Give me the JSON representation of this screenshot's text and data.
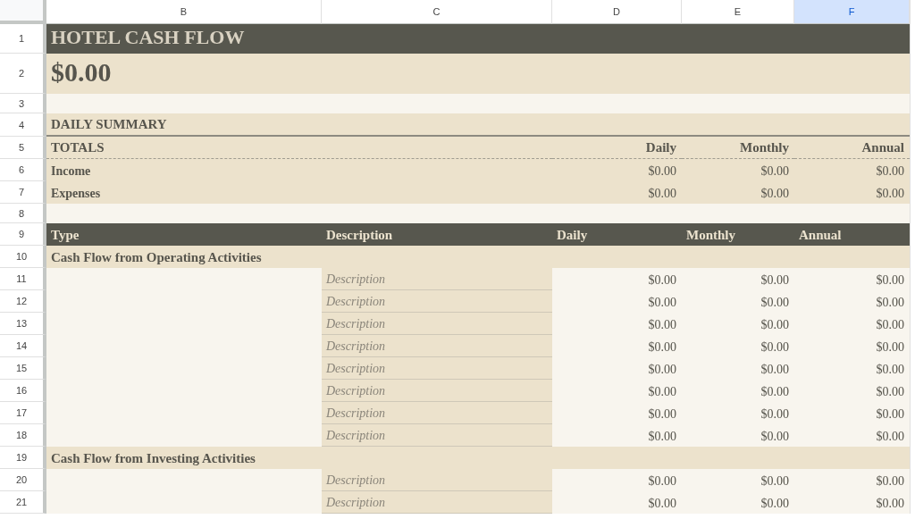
{
  "column_headers": [
    {
      "label": "B",
      "selected": false
    },
    {
      "label": "C",
      "selected": false
    },
    {
      "label": "D",
      "selected": false
    },
    {
      "label": "E",
      "selected": false
    },
    {
      "label": "F",
      "selected": true
    }
  ],
  "row_numbers": [
    "1",
    "2",
    "3",
    "4",
    "5",
    "6",
    "7",
    "8",
    "9",
    "10",
    "11",
    "12",
    "13",
    "14",
    "15",
    "16",
    "17",
    "18",
    "19",
    "20",
    "21"
  ],
  "title": "HOTEL CASH FLOW",
  "total": "$0.00",
  "summary": {
    "heading": "DAILY SUMMARY",
    "label": "TOTALS",
    "columns": [
      "Daily",
      "Monthly",
      "Annual"
    ],
    "rows": [
      {
        "label": "Income",
        "values": [
          "$0.00",
          "$0.00",
          "$0.00"
        ]
      },
      {
        "label": "Expenses",
        "values": [
          "$0.00",
          "$0.00",
          "$0.00"
        ]
      }
    ]
  },
  "cash_flow": {
    "columns": [
      "Type",
      "Description",
      "Daily",
      "Monthly",
      "Annual"
    ],
    "sections": [
      {
        "title": "Cash Flow from Operating Activities",
        "rows": [
          {
            "description": "Description",
            "values": [
              "$0.00",
              "$0.00",
              "$0.00"
            ]
          },
          {
            "description": "Description",
            "values": [
              "$0.00",
              "$0.00",
              "$0.00"
            ]
          },
          {
            "description": "Description",
            "values": [
              "$0.00",
              "$0.00",
              "$0.00"
            ]
          },
          {
            "description": "Description",
            "values": [
              "$0.00",
              "$0.00",
              "$0.00"
            ]
          },
          {
            "description": "Description",
            "values": [
              "$0.00",
              "$0.00",
              "$0.00"
            ]
          },
          {
            "description": "Description",
            "values": [
              "$0.00",
              "$0.00",
              "$0.00"
            ]
          },
          {
            "description": "Description",
            "values": [
              "$0.00",
              "$0.00",
              "$0.00"
            ]
          },
          {
            "description": "Description",
            "values": [
              "$0.00",
              "$0.00",
              "$0.00"
            ]
          }
        ]
      },
      {
        "title": "Cash Flow from Investing Activities",
        "rows": [
          {
            "description": "Description",
            "values": [
              "$0.00",
              "$0.00",
              "$0.00"
            ]
          },
          {
            "description": "Description",
            "values": [
              "$0.00",
              "$0.00",
              "$0.00"
            ]
          }
        ]
      }
    ]
  }
}
